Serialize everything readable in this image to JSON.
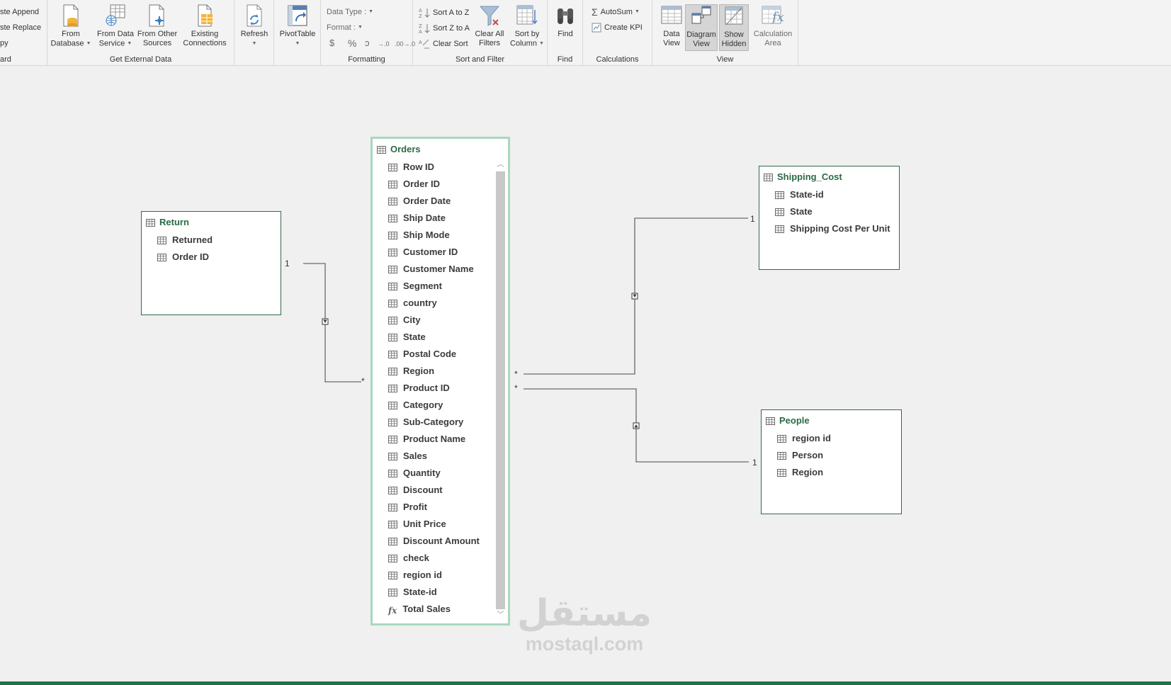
{
  "ribbon": {
    "clipboard": {
      "items": [
        "ste Append",
        "ste Replace",
        "py"
      ],
      "label": "ard"
    },
    "get_external_data": {
      "label": "Get External Data",
      "buttons": [
        {
          "line1": "From",
          "line2": "Database"
        },
        {
          "line1": "From Data",
          "line2": "Service"
        },
        {
          "line1": "From Other",
          "line2": "Sources"
        },
        {
          "line1": "Existing",
          "line2": "Connections"
        }
      ]
    },
    "refresh": {
      "label": "Refresh"
    },
    "pivottable": {
      "label": "PivotTable"
    },
    "formatting": {
      "label": "Formatting",
      "data_type": "Data Type :",
      "format": "Format :",
      "symbols": [
        "$",
        "%",
        "ɔ",
        "→.0",
        ".00→.0"
      ]
    },
    "sort_filter": {
      "label": "Sort and Filter",
      "sort_az": "Sort A to Z",
      "sort_za": "Sort Z to A",
      "clear_sort": "Clear Sort",
      "clear_all_filters": {
        "line1": "Clear All",
        "line2": "Filters"
      },
      "sort_by_column": {
        "line1": "Sort by",
        "line2": "Column"
      }
    },
    "find": {
      "label": "Find",
      "button": "Find"
    },
    "calculations": {
      "label": "Calculations",
      "autosum": "AutoSum",
      "create_kpi": "Create KPI"
    },
    "view": {
      "label": "View",
      "data_view": {
        "line1": "Data",
        "line2": "View"
      },
      "diagram_view": {
        "line1": "Diagram",
        "line2": "View"
      },
      "show_hidden": {
        "line1": "Show",
        "line2": "Hidden"
      },
      "calculation_area": {
        "line1": "Calculation",
        "line2": "Area"
      }
    }
  },
  "tables": {
    "orders": {
      "name": "Orders",
      "columns": [
        "Row ID",
        "Order ID",
        "Order Date",
        "Ship Date",
        "Ship Mode",
        "Customer ID",
        "Customer Name",
        "Segment",
        "country",
        "City",
        "State",
        "Postal Code",
        "Region",
        "Product ID",
        "Category",
        "Sub-Category",
        "Product Name",
        "Sales",
        "Quantity",
        "Discount",
        "Profit",
        "Unit Price",
        "Discount Amount",
        "check",
        "region id",
        "State-id"
      ],
      "measure": "Total Sales"
    },
    "return": {
      "name": "Return",
      "columns": [
        "Returned",
        "Order ID"
      ]
    },
    "shipping_cost": {
      "name": "Shipping_Cost",
      "columns": [
        "State-id",
        "State",
        "Shipping Cost Per Unit"
      ]
    },
    "people": {
      "name": "People",
      "columns": [
        "region id",
        "Person",
        "Region"
      ]
    }
  },
  "relationships": {
    "return_one": "1",
    "orders_many_return": "*",
    "orders_many_shipping": "*",
    "orders_many_people": "*",
    "shipping_one": "1",
    "people_one": "1"
  },
  "watermark": {
    "arabic": "مستقل",
    "latin": "mostaql.com"
  }
}
